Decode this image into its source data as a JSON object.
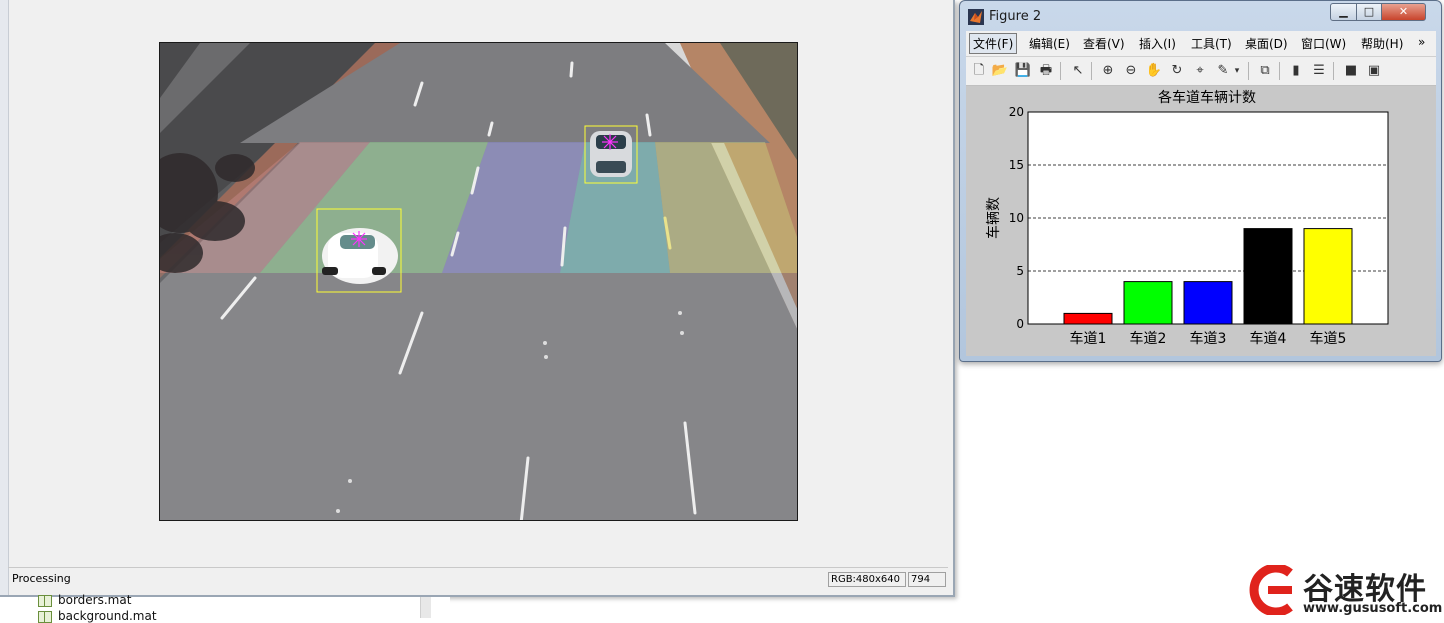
{
  "video_window": {
    "status_text": "Processing",
    "rgb_readout": "RGB:480x640",
    "value_readout": "794"
  },
  "file_list": [
    "borders.mat",
    "background.mat"
  ],
  "figure_window": {
    "title": "Figure 2",
    "menu": [
      "文件(F)",
      "编辑(E)",
      "查看(V)",
      "插入(I)",
      "工具(T)",
      "桌面(D)",
      "窗口(W)",
      "帮助(H)"
    ],
    "menu_overflow": "»",
    "toolbar_icons": [
      "new-file-icon",
      "open-folder-icon",
      "save-icon",
      "print-icon",
      "pointer-icon",
      "zoom-in-icon",
      "zoom-out-icon",
      "pan-hand-icon",
      "rotate-3d-icon",
      "data-cursor-icon",
      "brush-icon",
      "link-plot-icon",
      "colorbar-icon",
      "legend-icon",
      "hide-plot-tools-icon",
      "show-plot-tools-icon"
    ]
  },
  "chart_data": {
    "type": "bar",
    "title": "各车道车辆计数",
    "xlabel": "",
    "ylabel": "车辆数",
    "categories": [
      "车道1",
      "车道2",
      "车道3",
      "车道4",
      "车道5"
    ],
    "values": [
      1,
      4,
      4,
      9,
      9
    ],
    "colors": [
      "#ff0000",
      "#00ff00",
      "#0000ff",
      "#000000",
      "#ffff00"
    ],
    "ylim": [
      0,
      20
    ],
    "yticks": [
      0,
      5,
      10,
      15,
      20
    ],
    "grid": "dashed horizontal",
    "legend": "none"
  },
  "logo": {
    "name": "谷速软件",
    "url": "www.gususoft.com",
    "color": "#e0231c"
  }
}
